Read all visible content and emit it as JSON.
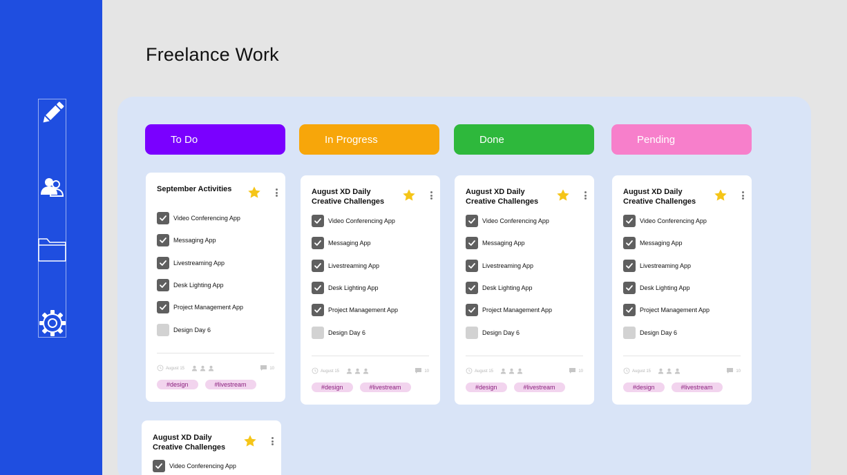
{
  "page": {
    "title": "Freelance Work"
  },
  "sidebar": {
    "items": [
      {
        "icon": "pencil-icon"
      },
      {
        "icon": "users-icon"
      },
      {
        "icon": "folder-icon"
      },
      {
        "icon": "gear-icon"
      }
    ]
  },
  "columns": [
    {
      "title": "To Do",
      "color": "#7a00ff",
      "card": {
        "title": "September Activities",
        "tasks": [
          {
            "label": "Video Conferencing App",
            "done": true
          },
          {
            "label": "Messaging App",
            "done": true
          },
          {
            "label": "Livestreaming App",
            "done": true
          },
          {
            "label": "Desk Lighting App",
            "done": true
          },
          {
            "label": "Project Management App",
            "done": true
          },
          {
            "label": "Design Day 6",
            "done": false
          }
        ],
        "date": "August 15",
        "comments": "10",
        "tags": [
          "#design",
          "#livestream"
        ]
      }
    },
    {
      "title": "In Progress",
      "color": "#f7a60a",
      "card": {
        "title": "August XD Daily Creative Challenges",
        "tasks": [
          {
            "label": "Video Conferencing App",
            "done": true
          },
          {
            "label": "Messaging App",
            "done": true
          },
          {
            "label": "Livestreaming App",
            "done": true
          },
          {
            "label": "Desk Lighting App",
            "done": true
          },
          {
            "label": "Project Management App",
            "done": true
          },
          {
            "label": "Design Day 6",
            "done": false
          }
        ],
        "date": "August 15",
        "comments": "10",
        "tags": [
          "#design",
          "#livestream"
        ]
      }
    },
    {
      "title": "Done",
      "color": "#2eb83c",
      "card": {
        "title": "August XD Daily Creative Challenges",
        "tasks": [
          {
            "label": "Video Conferencing App",
            "done": true
          },
          {
            "label": "Messaging App",
            "done": true
          },
          {
            "label": "Livestreaming App",
            "done": true
          },
          {
            "label": "Desk Lighting App",
            "done": true
          },
          {
            "label": "Project Management App",
            "done": true
          },
          {
            "label": "Design Day 6",
            "done": false
          }
        ],
        "date": "August 15",
        "comments": "10",
        "tags": [
          "#design",
          "#livestream"
        ]
      }
    },
    {
      "title": "Pending",
      "color": "#f77fcb",
      "card": {
        "title": "August XD Daily Creative Challenges",
        "tasks": [
          {
            "label": "Video Conferencing App",
            "done": true
          },
          {
            "label": "Messaging App",
            "done": true
          },
          {
            "label": "Livestreaming App",
            "done": true
          },
          {
            "label": "Desk Lighting App",
            "done": true
          },
          {
            "label": "Project Management App",
            "done": true
          },
          {
            "label": "Design Day 6",
            "done": false
          }
        ],
        "date": "August 15",
        "comments": "10",
        "tags": [
          "#design",
          "#livestream"
        ]
      }
    }
  ],
  "extra_card": {
    "title": "August XD Daily Creative Challenges",
    "tasks": [
      {
        "label": "Video Conferencing App",
        "done": true
      }
    ]
  },
  "colors": {
    "sidebar": "#1f4ee0",
    "board": "#d9e4f7",
    "star": "#f5c518",
    "tag_bg": "#f2d4ee",
    "tag_text": "#8a1f7d"
  }
}
